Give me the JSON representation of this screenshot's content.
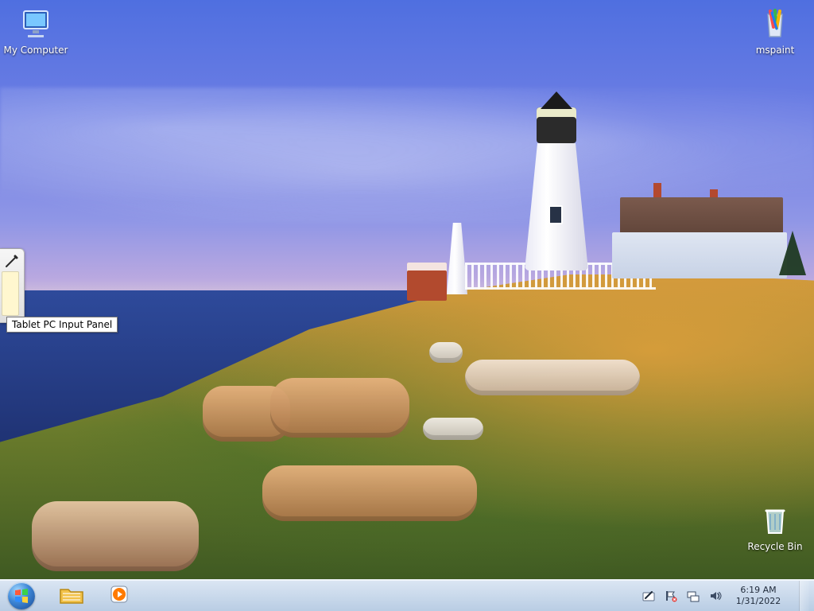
{
  "desktop": {
    "icons": [
      {
        "name": "My Computer",
        "icon": "computer-icon"
      },
      {
        "name": "mspaint",
        "icon": "paint-icon"
      },
      {
        "name": "Recycle Bin",
        "icon": "recycle-bin-icon"
      }
    ],
    "tablet_input_panel": {
      "tooltip": "Tablet PC Input Panel"
    }
  },
  "taskbar": {
    "start_button": {
      "icon": "windows-logo-icon"
    },
    "pinned": [
      {
        "icon": "file-explorer-icon"
      },
      {
        "icon": "media-player-icon"
      }
    ],
    "tray": {
      "icons": [
        "pen-input-icon",
        "action-center-icon",
        "network-icon",
        "volume-icon"
      ],
      "time": "6:19 AM",
      "date": "1/31/2022"
    }
  },
  "colors": {
    "taskbar_top": "#dbe6f3",
    "taskbar_bottom": "#b9cde4",
    "desktop_label": "#ffffff"
  }
}
